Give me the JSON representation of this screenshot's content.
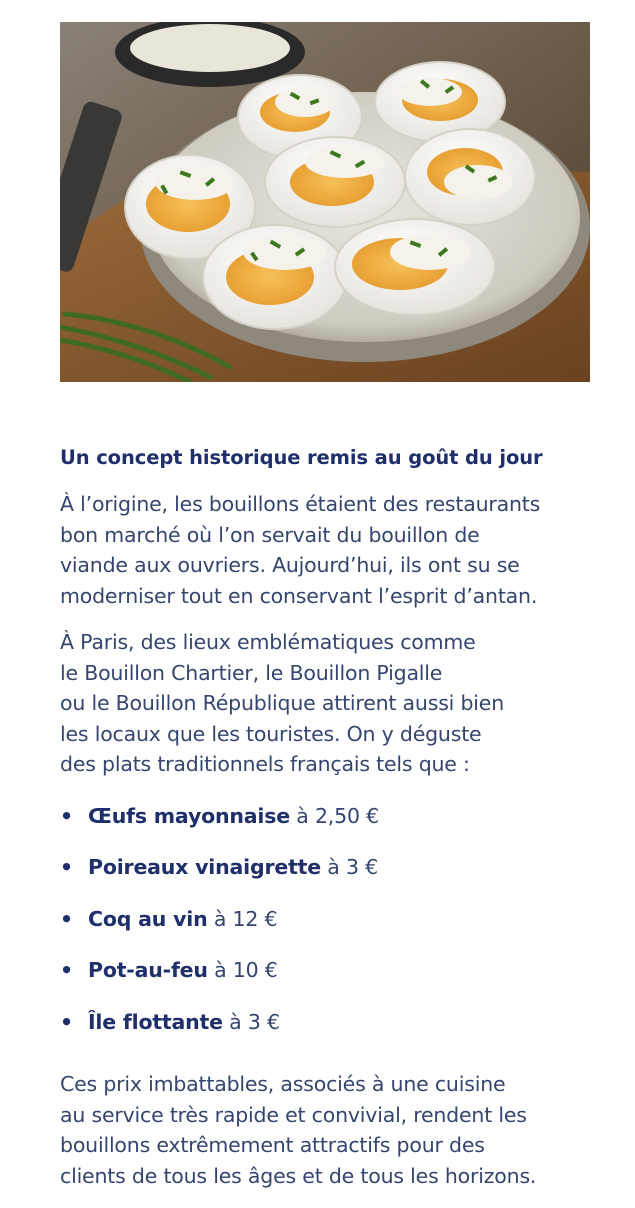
{
  "image": {
    "subject": "eggs-mayonnaise-plate"
  },
  "colors": {
    "heading": "#1f2f6b",
    "body_text": "#34456f",
    "background": "#ffffff"
  },
  "article": {
    "heading": "Un concept historique remis au goût du jour",
    "paragraph1": [
      "À l’origine, les bouillons étaient des restaurants",
      "bon marché où l’on servait du bouillon de",
      "viande aux ouvriers. Aujourd’hui, ils ont su se",
      "moderniser tout en conservant l’esprit d’antan."
    ],
    "paragraph2": [
      "À Paris, des lieux emblématiques comme",
      "le Bouillon Chartier, le  Bouillon Pigalle",
      "ou le Bouillon République attirent aussi bien",
      "les locaux que les touristes. On y déguste",
      "des plats traditionnels français tels que :"
    ],
    "bullet_symbol": "•",
    "dishes": [
      {
        "name": "Œufs mayonnaise",
        "price": " à 2,50 €"
      },
      {
        "name": "Poireaux vinaigrette",
        "price": " à 3 €"
      },
      {
        "name": "Coq au vin",
        "price": " à 12 €"
      },
      {
        "name": "Pot-au-feu",
        "price": " à 10 €"
      },
      {
        "name": "Île flottante",
        "price": " à 3 €"
      }
    ],
    "paragraph3": [
      "Ces prix imbattables, associés à une cuisine",
      "au service très rapide et convivial, rendent les",
      "bouillons extrêmement attractifs pour des",
      "clients de tous les âges et de tous les horizons."
    ]
  }
}
